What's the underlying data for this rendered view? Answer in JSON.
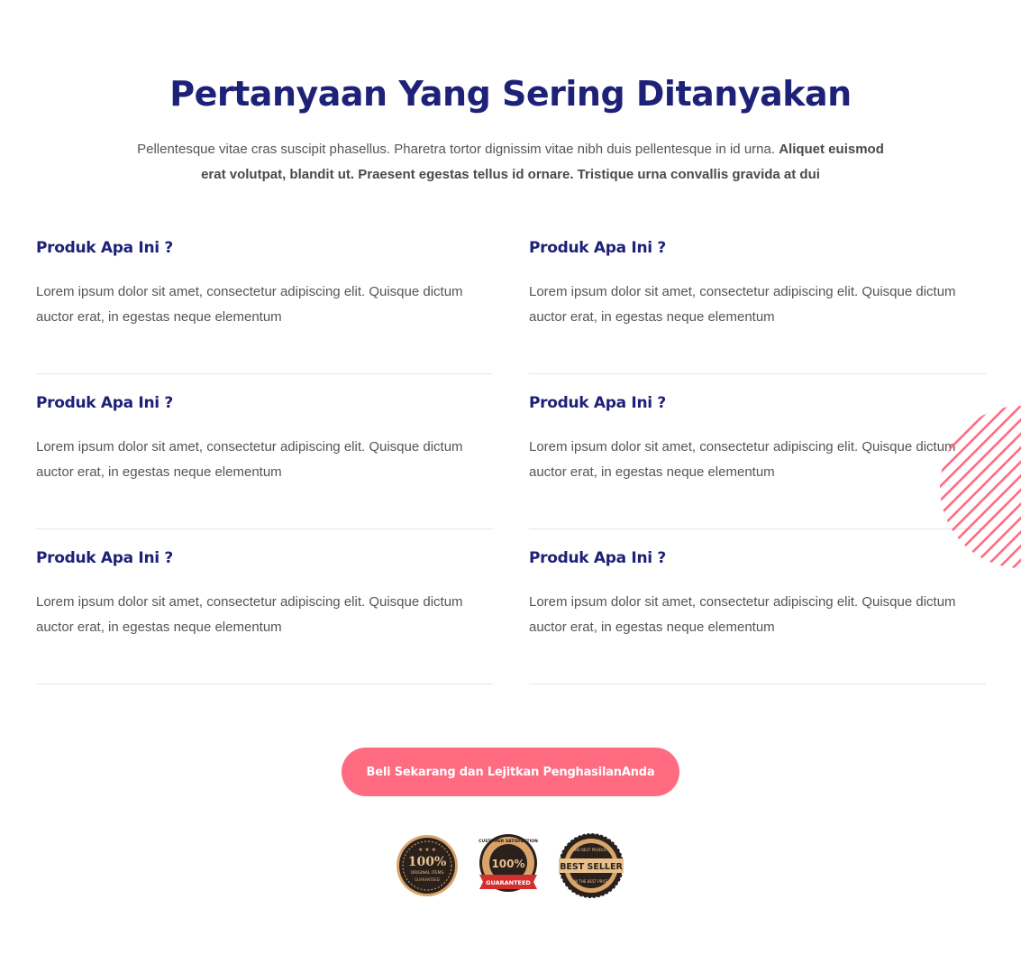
{
  "header": {
    "title": "Pertanyaan Yang Sering Ditanyakan",
    "intro_regular": "Pellentesque vitae cras suscipit phasellus. Pharetra tortor dignissim vitae nibh duis pellentesque in id urna.",
    "intro_bold": "Aliquet euismod erat volutpat, blandit ut. Praesent egestas tellus id ornare. Tristique urna convallis gravida at dui"
  },
  "faq": [
    {
      "question": "Produk Apa Ini ?",
      "answer": "Lorem ipsum dolor sit amet, consectetur adipiscing elit. Quisque dictum auctor erat, in egestas neque elementum"
    },
    {
      "question": "Produk Apa Ini ?",
      "answer": "Lorem ipsum dolor sit amet, consectetur adipiscing elit. Quisque dictum auctor erat, in egestas neque elementum"
    },
    {
      "question": "Produk Apa Ini ?",
      "answer": "Lorem ipsum dolor sit amet, consectetur adipiscing elit. Quisque dictum auctor erat, in egestas neque elementum"
    },
    {
      "question": "Produk Apa Ini ?",
      "answer": "Lorem ipsum dolor sit amet, consectetur adipiscing elit. Quisque dictum auctor erat, in egestas neque elementum"
    },
    {
      "question": "Produk Apa Ini ?",
      "answer": "Lorem ipsum dolor sit amet, consectetur adipiscing elit. Quisque dictum auctor erat, in egestas neque elementum"
    },
    {
      "question": "Produk Apa Ini ?",
      "answer": "Lorem ipsum dolor sit amet, consectetur adipiscing elit. Quisque dictum auctor erat, in egestas neque elementum"
    }
  ],
  "cta": {
    "label": "Beli Sekarang dan Lejitkan PenghasilanAnda"
  },
  "badges": {
    "original": {
      "big": "100%",
      "line1": "ORIGINAL ITEMS",
      "line2": "GUARANTEED"
    },
    "satisfaction": {
      "top": "CUSTOMER SATISFACTION",
      "big": "100%",
      "ribbon": "GUARANTEED"
    },
    "bestseller": {
      "top": "THE BEST PRODUCT",
      "big": "BEST SELLER",
      "bottom": "IN THE BEST PRICE"
    }
  },
  "colors": {
    "title": "#1d2178",
    "accent": "#ff6b81",
    "text": "#555555",
    "divider": "#e6e6e6"
  },
  "icons": [
    "stripe-circle-decoration",
    "original-items-badge",
    "satisfaction-guaranteed-badge",
    "best-seller-badge"
  ]
}
